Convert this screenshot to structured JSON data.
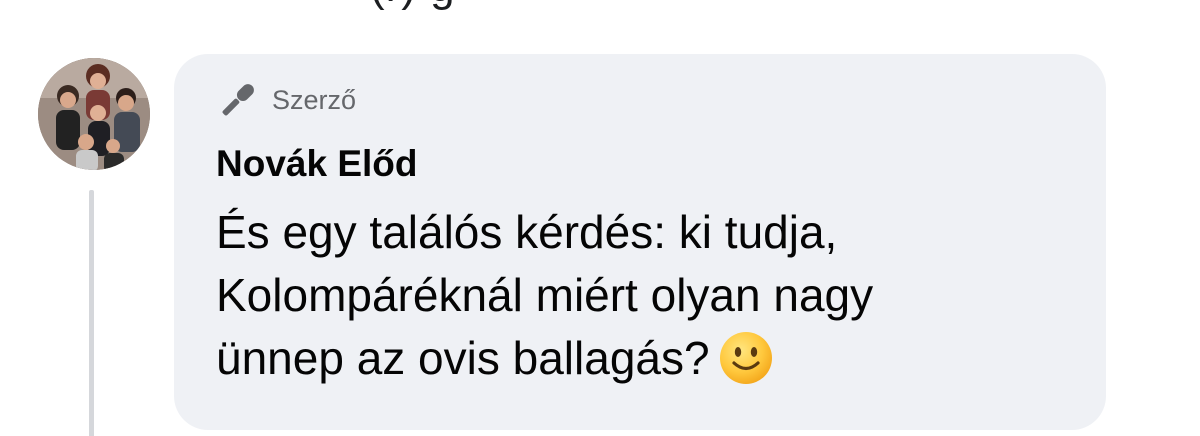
{
  "previous_comment": {
    "cutoff_text": "(r)                    g"
  },
  "comment": {
    "badge": {
      "icon": "microphone-icon",
      "label": "Szerző"
    },
    "author": "Novák Előd",
    "text_lines": [
      "És egy találós kérdés: ki tudja,",
      "Kolompáréknál miért olyan nagy",
      "ünnep az ovis ballagás?"
    ],
    "emoji": "slightly-smiling-face-icon"
  },
  "colors": {
    "bubble_bg": "#eff1f5",
    "text": "#050505",
    "muted": "#65676b",
    "thread_line": "#d5d7db"
  }
}
